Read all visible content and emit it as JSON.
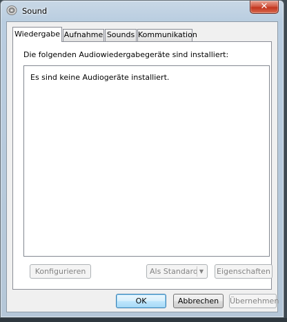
{
  "window": {
    "title": "Sound",
    "close_glyph": "✕"
  },
  "tabs": [
    {
      "label": "Wiedergabe",
      "active": true
    },
    {
      "label": "Aufnahme",
      "active": false
    },
    {
      "label": "Sounds",
      "active": false
    },
    {
      "label": "Kommunikation",
      "active": false
    }
  ],
  "panel": {
    "instruction": "Die folgenden Audiowiedergabegeräte sind installiert:",
    "empty_message": "Es sind keine Audiogeräte installiert."
  },
  "panel_buttons": {
    "configure": "Konfigurieren",
    "set_default": "Als Standard",
    "properties": "Eigenschaften"
  },
  "dialog_buttons": {
    "ok": "OK",
    "cancel": "Abbrechen",
    "apply": "Übernehmen"
  },
  "icons": {
    "app": "speaker-icon",
    "close": "close-icon",
    "dropdown": "chevron-down-icon"
  },
  "colors": {
    "close_button": "#c2361f",
    "default_button_border": "#3c7fb1",
    "client_background": "#f0f0f0"
  }
}
